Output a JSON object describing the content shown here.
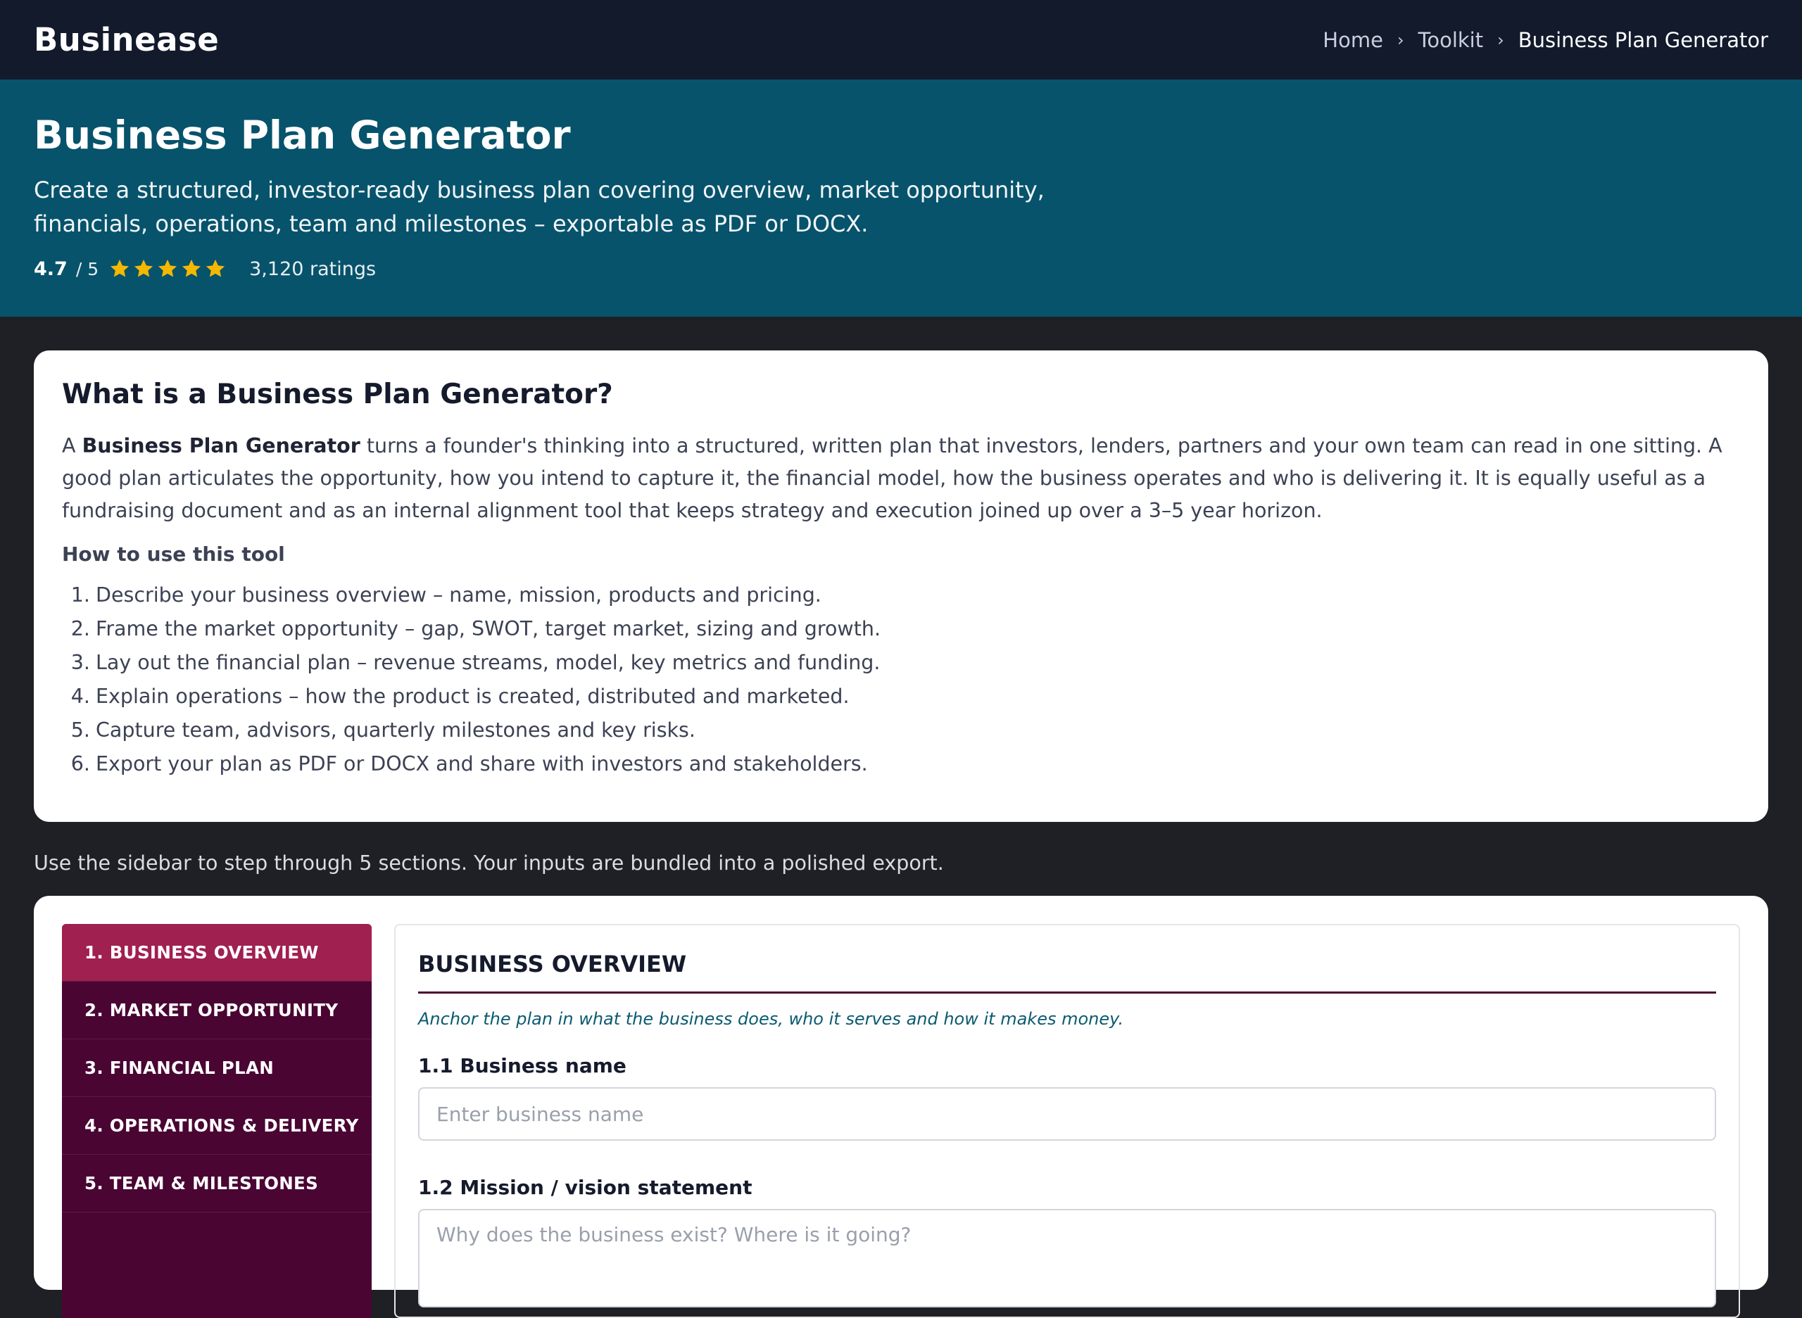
{
  "nav": {
    "brand": "Businease",
    "breadcrumb": [
      {
        "label": "Home"
      },
      {
        "label": "Toolkit"
      },
      {
        "label": "Business Plan Generator"
      }
    ],
    "separator": "›"
  },
  "hero": {
    "title": "Business Plan Generator",
    "description": "Create a structured, investor-ready business plan covering overview, market opportunity, financials, operations, team and milestones – exportable as PDF or DOCX.",
    "rating": {
      "value": "4.7",
      "scale": "/ 5",
      "stars": 5,
      "count": "3,120 ratings",
      "star_color": "#f5b800"
    }
  },
  "info": {
    "title": "What is a Business Plan Generator?",
    "intro_prefix": "A ",
    "intro_bold": "Business Plan Generator",
    "intro_rest": " turns a founder's thinking into a structured, written plan that investors, lenders, partners and your own team can read in one sitting. A good plan articulates the opportunity, how you intend to capture it, the financial model, how the business operates and who is delivering it. It is equally useful as a fundraising document and as an internal alignment tool that keeps strategy and execution joined up over a 3–5 year horizon.",
    "howto_title": "How to use this tool",
    "steps": [
      {
        "num": "1.",
        "text": "Describe your business overview – name, mission, products and pricing."
      },
      {
        "num": "2.",
        "text": "Frame the market opportunity – gap, SWOT, target market, sizing and growth."
      },
      {
        "num": "3.",
        "text": "Lay out the financial plan – revenue streams, model, key metrics and funding."
      },
      {
        "num": "4.",
        "text": "Explain operations – how the product is created, distributed and marketed."
      },
      {
        "num": "5.",
        "text": "Capture team, advisors, quarterly milestones and key risks."
      },
      {
        "num": "6.",
        "text": "Export your plan as PDF or DOCX and share with investors and stakeholders."
      }
    ]
  },
  "helper_text": "Use the sidebar to step through 5 sections. Your inputs are bundled into a polished export.",
  "sidebar": {
    "items": [
      {
        "label": "1. BUSINESS OVERVIEW",
        "active": true
      },
      {
        "label": "2. MARKET OPPORTUNITY",
        "active": false
      },
      {
        "label": "3. FINANCIAL PLAN",
        "active": false
      },
      {
        "label": "4. OPERATIONS & DELIVERY",
        "active": false
      },
      {
        "label": "5. TEAM & MILESTONES",
        "active": false
      }
    ]
  },
  "form": {
    "section_title": "BUSINESS OVERVIEW",
    "section_hint": "Anchor the plan in what the business does, who it serves and how it makes money.",
    "fields": [
      {
        "label": "1.1 Business name",
        "placeholder": "Enter business name",
        "value": ""
      },
      {
        "label": "1.2 Mission / vision statement",
        "placeholder": "Why does the business exist? Where is it going?",
        "value": ""
      }
    ]
  },
  "colors": {
    "nav_bg": "#121a2c",
    "hero_bg": "#07536b",
    "sidebar_bg": "#4a0533",
    "sidebar_active": "#a0204f",
    "accent_hint": "#0b5a70"
  }
}
